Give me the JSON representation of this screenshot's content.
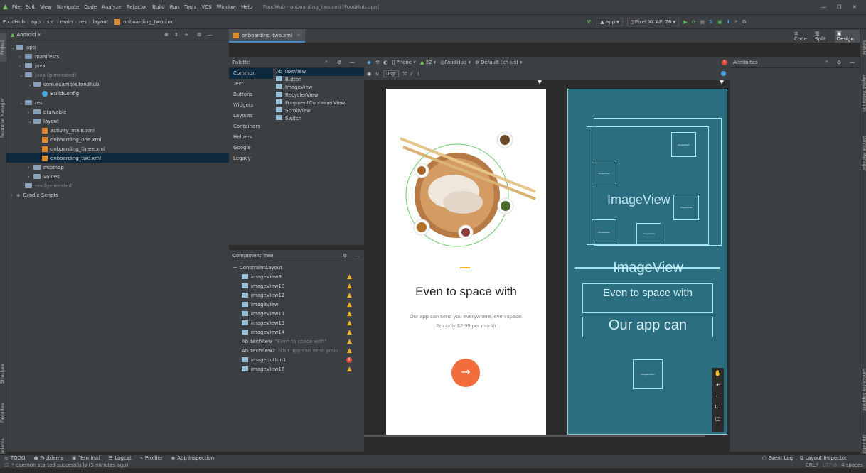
{
  "menu": [
    "File",
    "Edit",
    "View",
    "Navigate",
    "Code",
    "Analyze",
    "Refactor",
    "Build",
    "Run",
    "Tools",
    "VCS",
    "Window",
    "Help"
  ],
  "window_title": "FoodHub - onboarding_two.xml [FoodHub.app]",
  "breadcrumb": [
    "FoodHub",
    "app",
    "src",
    "main",
    "res",
    "layout",
    "onboarding_two.xml"
  ],
  "run_config": "app",
  "device": "Pixel XL API 26",
  "project_view": "Android",
  "project_tree": [
    {
      "label": "app",
      "indent": 0,
      "arrow": "v",
      "icon": "folder"
    },
    {
      "label": "manifests",
      "indent": 1,
      "arrow": ">",
      "icon": "folder"
    },
    {
      "label": "java",
      "indent": 1,
      "arrow": ">",
      "icon": "folder"
    },
    {
      "label": "java (generated)",
      "indent": 1,
      "arrow": "v",
      "icon": "folder"
    },
    {
      "label": "com.example.foodhub",
      "indent": 2,
      "arrow": "v",
      "icon": "folder"
    },
    {
      "label": "BuildConfig",
      "indent": 3,
      "arrow": "",
      "icon": "class"
    },
    {
      "label": "res",
      "indent": 1,
      "arrow": "v",
      "icon": "folder"
    },
    {
      "label": "drawable",
      "indent": 2,
      "arrow": ">",
      "icon": "folder"
    },
    {
      "label": "layout",
      "indent": 2,
      "arrow": "v",
      "icon": "folder"
    },
    {
      "label": "activity_main.xml",
      "indent": 3,
      "arrow": "",
      "icon": "xml"
    },
    {
      "label": "onboarding_one.xml",
      "indent": 3,
      "arrow": "",
      "icon": "xml"
    },
    {
      "label": "onboarding_three.xml",
      "indent": 3,
      "arrow": "",
      "icon": "xml"
    },
    {
      "label": "onboarding_two.xml",
      "indent": 3,
      "arrow": "",
      "icon": "xml",
      "selected": true
    },
    {
      "label": "mipmap",
      "indent": 2,
      "arrow": ">",
      "icon": "folder"
    },
    {
      "label": "values",
      "indent": 2,
      "arrow": ">",
      "icon": "folder"
    },
    {
      "label": "res (generated)",
      "indent": 1,
      "arrow": "",
      "icon": "folder"
    },
    {
      "label": "Gradle Scripts",
      "indent": 0,
      "arrow": ">",
      "icon": "gradle"
    }
  ],
  "editor_tab": "onboarding_two.xml",
  "view_modes": [
    "Code",
    "Split",
    "Design"
  ],
  "palette_title": "Palette",
  "palette_categories": [
    "Common",
    "Text",
    "Buttons",
    "Widgets",
    "Layouts",
    "Containers",
    "Helpers",
    "Google",
    "Legacy"
  ],
  "palette_items": [
    "Ab TextView",
    "Button",
    "ImageView",
    "RecyclerView",
    "FragmentContainerView",
    "ScrollView",
    "Switch"
  ],
  "design_toolbar": {
    "phone": "Phone",
    "api": "32",
    "theme": "FoodHub",
    "locale": "Default (en-us)",
    "margin": "0dp"
  },
  "attributes_title": "Attributes",
  "component_tree_title": "Component Tree",
  "component_tree": [
    {
      "label": "ConstraintLayout",
      "status": "none",
      "root": true
    },
    {
      "label": "imageView3",
      "status": "warn"
    },
    {
      "label": "imageView10",
      "status": "warn"
    },
    {
      "label": "imageView12",
      "status": "warn"
    },
    {
      "label": "imageView",
      "status": "warn"
    },
    {
      "label": "imageView11",
      "status": "warn"
    },
    {
      "label": "imageView13",
      "status": "warn"
    },
    {
      "label": "imageView14",
      "status": "warn"
    },
    {
      "label": "textView",
      "hint": "\"Even to space with\"",
      "status": "warn",
      "text": true
    },
    {
      "label": "textView2",
      "hint": "\"Our app can send you ev...\"",
      "status": "warn",
      "text": true
    },
    {
      "label": "imagebutton1",
      "status": "error"
    },
    {
      "label": "imageView16",
      "status": "warn"
    }
  ],
  "phone_preview": {
    "title": "Even to space with",
    "body": "Our app can send you everywhere, even space. For only $2.99 per month",
    "button_arrow": "→"
  },
  "blueprint": {
    "image_view": "ImageView",
    "title": "Even to space with",
    "body": "Our app can",
    "small_labels": [
      "ImageView",
      "ImageView",
      "ImageView",
      "ImageView",
      "ImageView",
      "imageButton"
    ]
  },
  "zoom_controls": [
    "+",
    "−",
    "1:1"
  ],
  "left_tabs": [
    "Project",
    "Resource Manager",
    "Structure",
    "Favorites",
    "Build Variants"
  ],
  "right_tabs": [
    "Gradle",
    "Layout Validation",
    "Device Manager",
    "Device File Explorer",
    "Emulator"
  ],
  "bottom_tools": [
    "TODO",
    "Problems",
    "Terminal",
    "Logcat",
    "Profiler",
    "App Inspection"
  ],
  "bottom_right_tools": [
    "Event Log",
    "Layout Inspector"
  ],
  "status_message": "* daemon started successfully (5 minutes ago)",
  "status_right": [
    "CRLF",
    "UTF-8",
    "4 spaces"
  ],
  "colors": {
    "accent": "#f36d3c",
    "blueprint": "#2a6e80",
    "ide_bg": "#3c3f41",
    "selection": "#0d293e"
  }
}
